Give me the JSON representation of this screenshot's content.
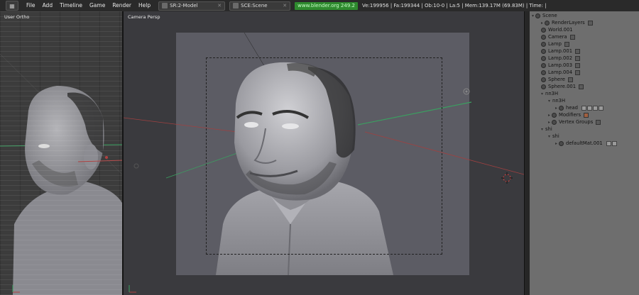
{
  "topbar": {
    "menu": [
      "File",
      "Add",
      "Timeline",
      "Game",
      "Render",
      "Help"
    ],
    "screen_dropdown": "SR:2-Model",
    "scene_dropdown": "SCE:Scene",
    "url": "www.blender.org 249.2",
    "stats": "Ve:199956 | Fa:199344 | Ob:10-0 | La:5  | Mem:139.17M (69.83M)  | Time: |"
  },
  "left_view": {
    "label": "User Ortho"
  },
  "camera_view": {
    "label": "Camera Persp"
  },
  "outliner": {
    "items": [
      {
        "label": "Scene",
        "key": "scene"
      },
      {
        "label": "RenderLayers",
        "key": "renderlayers"
      },
      {
        "label": "World.001",
        "key": "world"
      },
      {
        "label": "Camera",
        "key": "camera"
      },
      {
        "label": "Lamp",
        "key": "lamp"
      },
      {
        "label": "Lamp.001",
        "key": "lamp001"
      },
      {
        "label": "Lamp.002",
        "key": "lamp002"
      },
      {
        "label": "Lamp.003",
        "key": "lamp003"
      },
      {
        "label": "Lamp.004",
        "key": "lamp004"
      },
      {
        "label": "Sphere",
        "key": "sphere"
      },
      {
        "label": "Sphere.001",
        "key": "sphere001"
      },
      {
        "label": "nn3H",
        "key": "nn3h"
      },
      {
        "label": "nn3H",
        "key": "nn3h-mesh"
      },
      {
        "label": "head",
        "key": "head"
      },
      {
        "label": "Modifiers",
        "key": "modifiers"
      },
      {
        "label": "Vertex Groups",
        "key": "vertex-groups"
      },
      {
        "label": "shi",
        "key": "shi"
      },
      {
        "label": "shi",
        "key": "shi-mesh"
      },
      {
        "label": "defaultMat.001",
        "key": "defaultmat"
      }
    ]
  },
  "colors": {
    "x_axis": "#b04040",
    "y_axis": "#3aa060",
    "active_url": "#2e8a2e",
    "outliner_bg": "#6e6e6e"
  }
}
